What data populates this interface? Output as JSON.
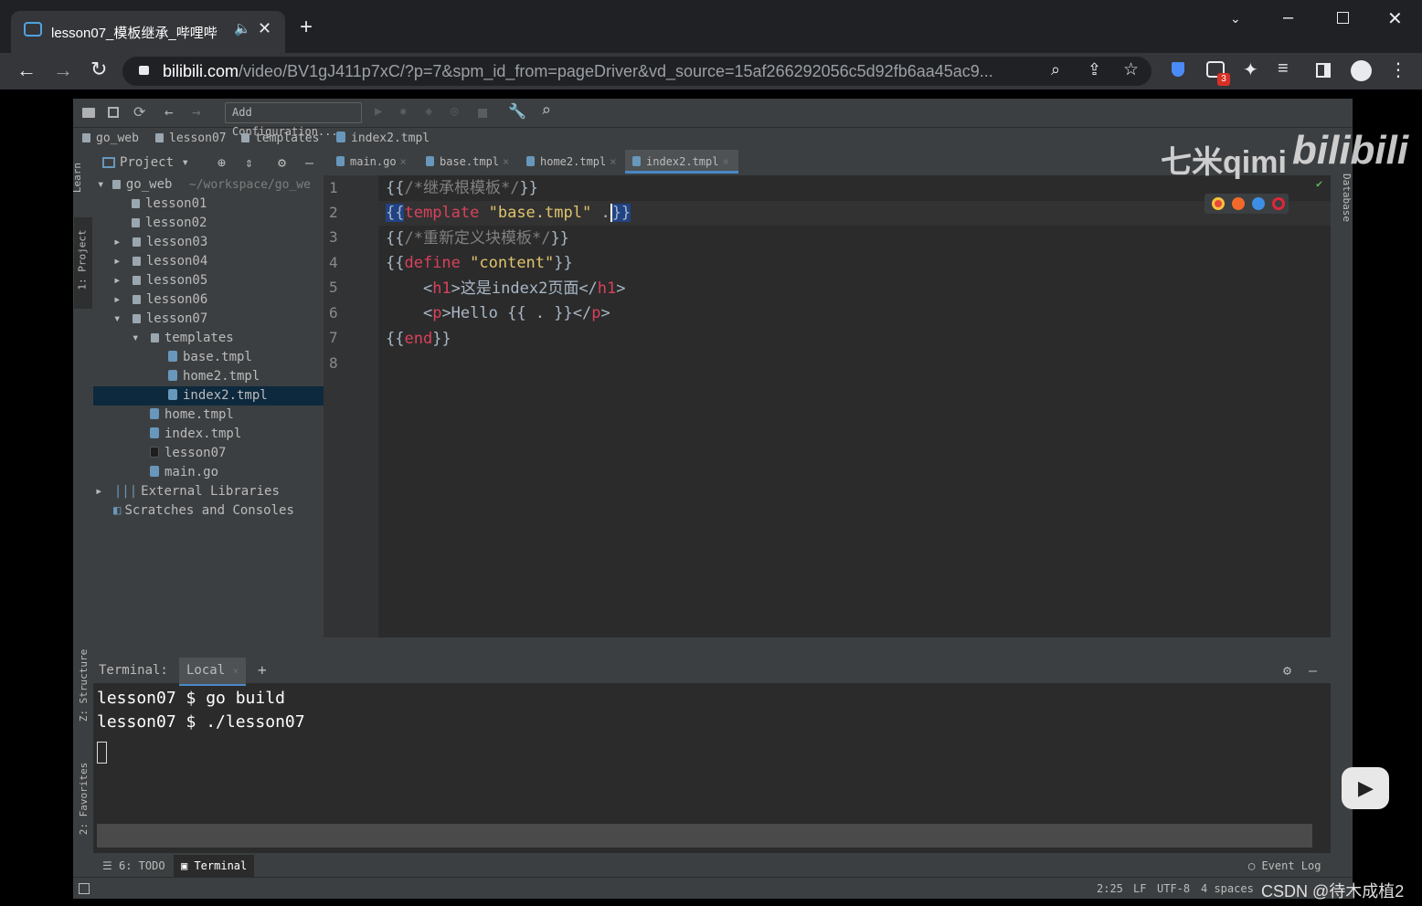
{
  "browser": {
    "tab_title": "lesson07_模板继承_哔哩哔",
    "url_domain": "bilibili.com",
    "url_path": "/video/BV1gJ411p7xC/?p=7&spm_id_from=pageDriver&vd_source=15af266292056c5d92fb6aa45ac9...",
    "extension_badge": "3"
  },
  "ide": {
    "run_config": "Add Configuration...",
    "breadcrumbs": [
      "go_web",
      "lesson07",
      "templates",
      "index2.tmpl"
    ],
    "project_label": "Project",
    "tool_left": {
      "learn": "Learn",
      "project": "1: Project",
      "structure": "Z: Structure",
      "favorites": "2: Favorites"
    },
    "tool_right": {
      "database": "Database"
    },
    "editor_tabs": [
      "main.go",
      "base.tmpl",
      "home2.tmpl",
      "index2.tmpl"
    ],
    "tree": {
      "root": "go_web",
      "root_path": "~/workspace/go_we",
      "items": [
        "lesson01",
        "lesson02",
        "lesson03",
        "lesson04",
        "lesson05",
        "lesson06",
        "lesson07",
        "templates",
        "base.tmpl",
        "home2.tmpl",
        "index2.tmpl",
        "home.tmpl",
        "index.tmpl",
        "lesson07",
        "main.go",
        "External Libraries",
        "Scratches and Consoles"
      ]
    },
    "line_numbers": [
      "1",
      "2",
      "3",
      "4",
      "5",
      "6",
      "7",
      "8"
    ],
    "code": {
      "l1a": "{{",
      "l1b": "/*继承根模板*/",
      "l1c": "}}",
      "l2a": "{{",
      "l2b": "template",
      "l2c": " \"base.tmpl\" ",
      "l2d": ".",
      "l2e": "}}",
      "l3a": "{{",
      "l3b": "/*重新定义块模板*/",
      "l3c": "}}",
      "l4a": "{{",
      "l4b": "define",
      "l4c": " \"content\"",
      "l4d": "}}",
      "l5a": "    <",
      "l5b": "h1",
      "l5c": ">这是index2页面</",
      "l5d": "h1",
      "l5e": ">",
      "l6a": "    <",
      "l6b": "p",
      "l6c": ">Hello {{ . }}</",
      "l6d": "p",
      "l6e": ">",
      "l7a": "{{",
      "l7b": "end",
      "l7c": "}}"
    },
    "terminal": {
      "title": "Terminal:",
      "tab": "Local",
      "lines": [
        "lesson07 $ go build",
        "lesson07 $ ./lesson07"
      ]
    },
    "bottom_tabs": {
      "todo": "6: TODO",
      "terminal": "Terminal",
      "event_log": "Event Log"
    },
    "status": {
      "position": "2:25",
      "line_sep": "LF",
      "encoding": "UTF-8",
      "indent": "4 spaces"
    }
  },
  "overlay": {
    "watermark": "七米qimi",
    "logo": "bilibili",
    "csdn": "CSDN @待木成植2"
  }
}
